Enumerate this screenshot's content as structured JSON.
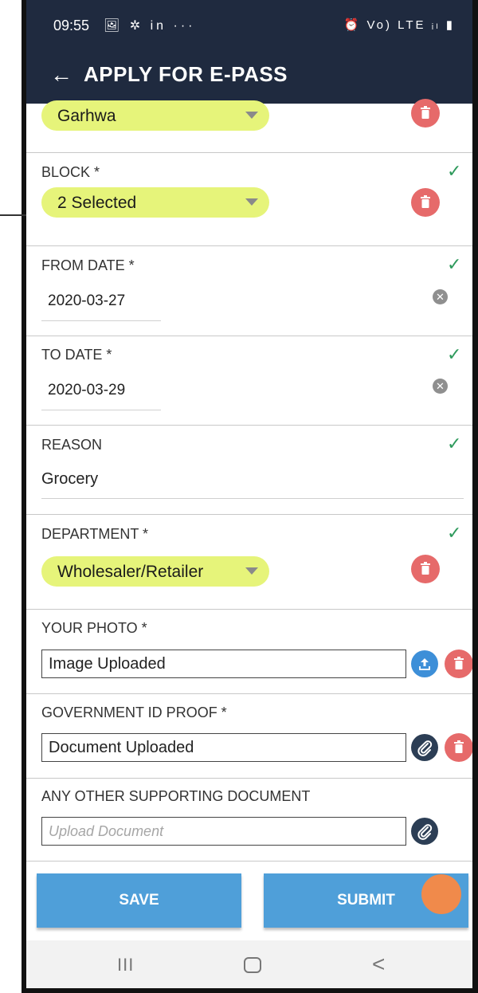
{
  "status_bar": {
    "time": "09:55",
    "left_icons": "🖼 ✲ in ···",
    "right_icons": "⏰ Vo) LTE ᵢₗ ▮"
  },
  "app_bar": {
    "title": "APPLY FOR E-PASS",
    "back_icon": "arrow-left-icon"
  },
  "district": {
    "value": "Garhwa"
  },
  "block": {
    "label": "BLOCK *",
    "value": "2 Selected",
    "valid": true
  },
  "from_date": {
    "label": "FROM DATE *",
    "value": "2020-03-27",
    "valid": true
  },
  "to_date": {
    "label": "TO DATE *",
    "value": "2020-03-29",
    "valid": true
  },
  "reason": {
    "label": "REASON",
    "value": "Grocery",
    "valid": true
  },
  "department": {
    "label": "DEPARTMENT *",
    "value": "Wholesaler/Retailer",
    "valid": true
  },
  "your_photo": {
    "label": "YOUR PHOTO  *",
    "value": "Image Uploaded"
  },
  "government_id": {
    "label": "GOVERNMENT ID PROOF  *",
    "value": "Document Uploaded"
  },
  "supporting_doc": {
    "label": "ANY OTHER SUPPORTING DOCUMENT",
    "placeholder": "Upload Document"
  },
  "actions": {
    "save_label": "SAVE",
    "submit_label": "SUBMIT"
  },
  "glyphs": {
    "check": "✓",
    "clear": "✕",
    "back": "←",
    "nav_recents": "III",
    "nav_back": "<"
  },
  "colors": {
    "app_bar": "#1f2a3f",
    "pill": "#e6f47a",
    "delete": "#e66a6a",
    "check": "#2e9a5c",
    "button": "#4f9fd9",
    "upload": "#3d8fd8",
    "attach": "#2c3e55",
    "touch_indicator": "#f08a4b"
  }
}
